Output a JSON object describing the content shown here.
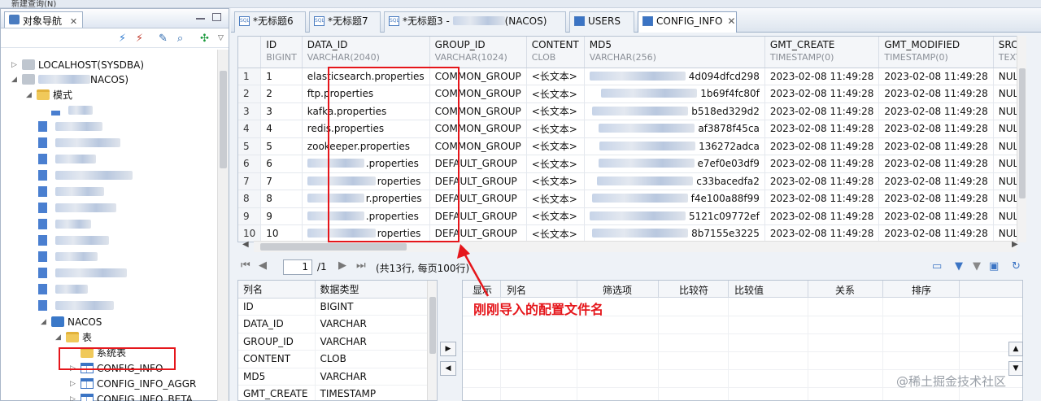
{
  "toolbar": {
    "new_query": "新建查询(N)"
  },
  "navigator": {
    "title": "对象导航",
    "close": "✕",
    "tree": {
      "server": "LOCALHOST(SYSDBA)",
      "db_suffix": "NACOS)",
      "mode_folder": "模式",
      "schema": "NACOS",
      "table_folder": "表",
      "system_tables": "系统表",
      "tables": [
        "CONFIG_INFO",
        "CONFIG_INFO_AGGR",
        "CONFIG_INFO_BETA"
      ]
    }
  },
  "editor_tabs": [
    {
      "label": "*无标题6",
      "icon": "sql-icon"
    },
    {
      "label": "*无标题7",
      "icon": "sql-icon"
    },
    {
      "label": "*无标题3 -",
      "suffix": "(NACOS)",
      "icon": "sql-icon"
    },
    {
      "label": "USERS",
      "icon": "table-icon"
    },
    {
      "label": "CONFIG_INFO",
      "close": "✕",
      "icon": "table-icon"
    }
  ],
  "grid": {
    "columns": [
      {
        "name": "ID",
        "type": "BIGINT"
      },
      {
        "name": "DATA_ID",
        "type": "VARCHAR(2040)"
      },
      {
        "name": "GROUP_ID",
        "type": "VARCHAR(1024)"
      },
      {
        "name": "CONTENT",
        "type": "CLOB"
      },
      {
        "name": "MD5",
        "type": "VARCHAR(256)"
      },
      {
        "name": "GMT_CREATE",
        "type": "TIMESTAMP(0)"
      },
      {
        "name": "GMT_MODIFIED",
        "type": "TIMESTAMP(0)"
      },
      {
        "name": "SRC_",
        "type": "TEXT"
      }
    ],
    "rows": [
      {
        "rn": "1",
        "id": "1",
        "data_id": "elasticsearch.properties",
        "group": "COMMON_GROUP",
        "content": "<长文本>",
        "md5": "4d094dfcd298",
        "create": "2023-02-08 11:49:28",
        "modified": "2023-02-08 11:49:28",
        "src": "NULL"
      },
      {
        "rn": "2",
        "id": "2",
        "data_id": "ftp.properties",
        "group": "COMMON_GROUP",
        "content": "<长文本>",
        "md5": "1b69f4fc80f",
        "create": "2023-02-08 11:49:28",
        "modified": "2023-02-08 11:49:28",
        "src": "NULL"
      },
      {
        "rn": "3",
        "id": "3",
        "data_id": "kafka.properties",
        "group": "COMMON_GROUP",
        "content": "<长文本>",
        "md5": "b518ed329d2",
        "create": "2023-02-08 11:49:28",
        "modified": "2023-02-08 11:49:28",
        "src": "NULL"
      },
      {
        "rn": "4",
        "id": "4",
        "data_id": "redis.properties",
        "group": "COMMON_GROUP",
        "content": "<长文本>",
        "md5": "af3878f45ca",
        "create": "2023-02-08 11:49:28",
        "modified": "2023-02-08 11:49:28",
        "src": "NULL"
      },
      {
        "rn": "5",
        "id": "5",
        "data_id": "zookeeper.properties",
        "group": "COMMON_GROUP",
        "content": "<长文本>",
        "md5": "136272adca",
        "create": "2023-02-08 11:49:28",
        "modified": "2023-02-08 11:49:28",
        "src": "NULL"
      },
      {
        "rn": "6",
        "id": "6",
        "data_id": ".properties",
        "group": "DEFAULT_GROUP",
        "content": "<长文本>",
        "md5": "e7ef0e03df9",
        "create": "2023-02-08 11:49:28",
        "modified": "2023-02-08 11:49:28",
        "src": "NULL"
      },
      {
        "rn": "7",
        "id": "7",
        "data_id": "roperties",
        "group": "DEFAULT_GROUP",
        "content": "<长文本>",
        "md5": "c33bacedfa2",
        "create": "2023-02-08 11:49:28",
        "modified": "2023-02-08 11:49:28",
        "src": "NULL"
      },
      {
        "rn": "8",
        "id": "8",
        "data_id": "r.properties",
        "group": "DEFAULT_GROUP",
        "content": "<长文本>",
        "md5": "f4e100a88f99",
        "create": "2023-02-08 11:49:28",
        "modified": "2023-02-08 11:49:28",
        "src": "NULL"
      },
      {
        "rn": "9",
        "id": "9",
        "data_id": ".properties",
        "group": "DEFAULT_GROUP",
        "content": "<长文本>",
        "md5": "5121c09772ef",
        "create": "2023-02-08 11:49:28",
        "modified": "2023-02-08 11:49:28",
        "src": "NULL"
      },
      {
        "rn": "10",
        "id": "10",
        "data_id": "roperties",
        "group": "DEFAULT_GROUP",
        "content": "<长文本>",
        "md5": "8b7155e3225",
        "create": "2023-02-08 11:49:28",
        "modified": "2023-02-08 11:49:28",
        "src": "NULL"
      }
    ]
  },
  "pager": {
    "page": "1",
    "total_pages": "/1",
    "summary": "(共13行, 每页100行)"
  },
  "column_panel": {
    "headers": [
      "列名",
      "数据类型"
    ],
    "rows": [
      [
        "ID",
        "BIGINT"
      ],
      [
        "DATA_ID",
        "VARCHAR"
      ],
      [
        "GROUP_ID",
        "VARCHAR"
      ],
      [
        "CONTENT",
        "CLOB"
      ],
      [
        "MD5",
        "VARCHAR"
      ],
      [
        "GMT_CREATE",
        "TIMESTAMP"
      ]
    ]
  },
  "filter_panel": {
    "headers": [
      "显示",
      "列名",
      "筛选项",
      "比较符",
      "比较值",
      "关系",
      "排序"
    ]
  },
  "annotation": "刚刚导入的配置文件名",
  "watermark": "@稀土掘金技术社区",
  "colors": {
    "highlight": "#e5161b",
    "accent": "#3b74c4"
  }
}
